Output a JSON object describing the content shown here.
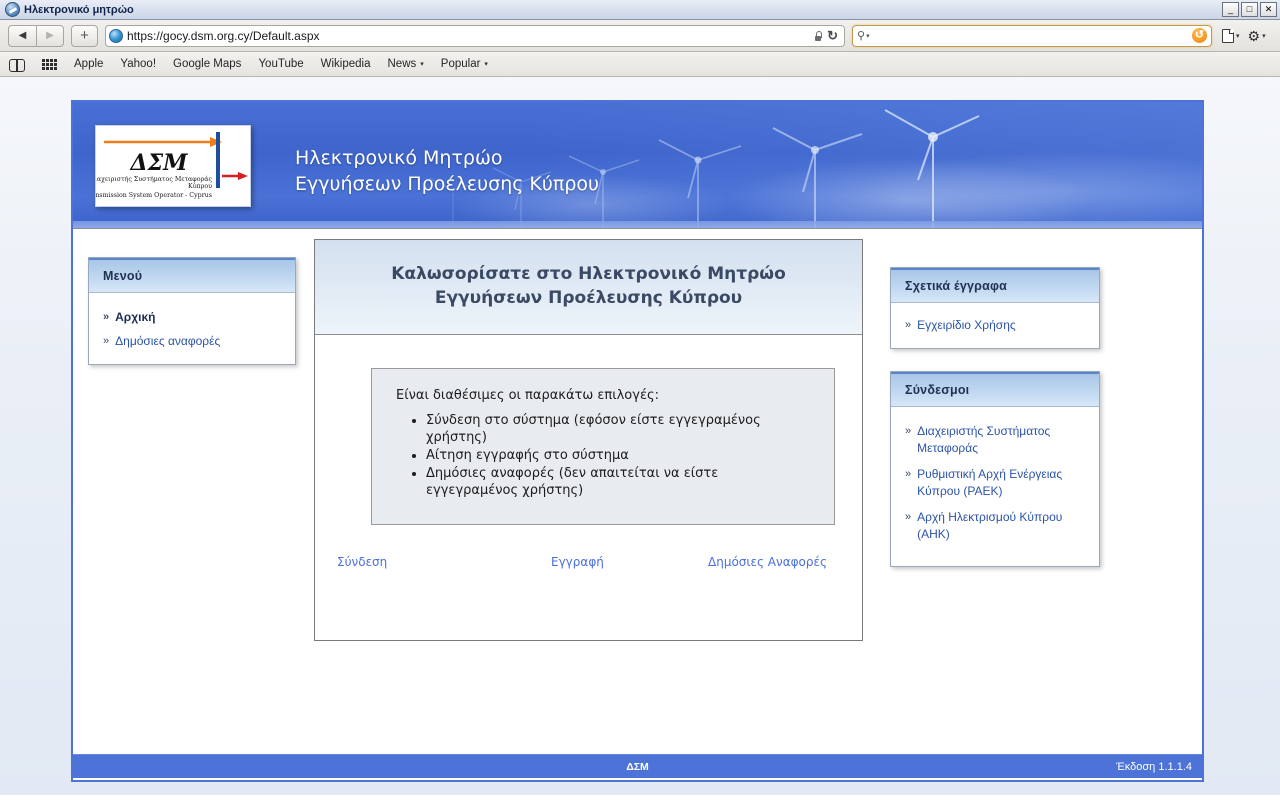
{
  "window": {
    "title": "Ηλεκτρονικό μητρώο",
    "icon": "compass-icon",
    "minimize": "_",
    "maximize": "□",
    "close": "✕"
  },
  "browser": {
    "back_icon": "◀",
    "forward_icon": "▶",
    "new_tab_icon": "+",
    "url": "https://gocy.dsm.org.cy/Default.aspx",
    "lock_icon": "lock-icon",
    "reload_icon": "↻",
    "search_placeholder": "",
    "search_value": "",
    "search_icon": "magnifier-icon",
    "search_caret": "▾",
    "stop_reload_icon": "↺",
    "page_menu_icon": "page-icon",
    "settings_icon": "gear-icon",
    "caret": "▾",
    "bookmarks": [
      {
        "label": "Apple",
        "has_caret": false
      },
      {
        "label": "Yahoo!",
        "has_caret": false
      },
      {
        "label": "Google Maps",
        "has_caret": false
      },
      {
        "label": "YouTube",
        "has_caret": false
      },
      {
        "label": "Wikipedia",
        "has_caret": false
      },
      {
        "label": "News",
        "has_caret": true
      },
      {
        "label": "Popular",
        "has_caret": true
      }
    ]
  },
  "site": {
    "banner": {
      "title_line1": "Ηλεκτρονικό Μητρώο",
      "title_line2": "Εγγυήσεων Προέλευσης Κύπρου",
      "logo": {
        "acronym": "ΔΣΜ",
        "subtitle_gr_line1": "Διαχειριστής Συστήματος Μεταφοράς",
        "subtitle_gr_line2": "Κύπρου",
        "subtitle_en": "Transmission System Operator - Cyprus"
      }
    },
    "menu_panel": {
      "title": "Μενού",
      "items": [
        {
          "label": "Αρχική",
          "active": true
        },
        {
          "label": "Δημόσιες αναφορές",
          "active": false
        }
      ]
    },
    "welcome": {
      "heading_line1": "Καλωσορίσατε στο Ηλεκτρονικό Μητρώο",
      "heading_line2": "Εγγυήσεων Προέλευσης Κύπρου",
      "intro": "Είναι διαθέσιμες οι παρακάτω επιλογές:",
      "options": [
        "Σύνδεση στο σύστημα (εφόσον είστε εγγεγραμένος χρήστης)",
        "Αίτηση εγγραφής στο σύστημα",
        "Δημόσιες αναφορές (δεν απαιτείται να είστε εγγεγραμένος χρήστης)"
      ],
      "actions": [
        {
          "label": "Σύνδεση"
        },
        {
          "label": "Εγγραφή"
        },
        {
          "label": "Δημόσιες Αναφορές"
        }
      ]
    },
    "documents_panel": {
      "title": "Σχετικά έγγραφα",
      "items": [
        {
          "label": "Εγχειρίδιο Χρήσης"
        }
      ]
    },
    "links_panel": {
      "title": "Σύνδεσμοι",
      "items": [
        {
          "label": "Διαχειριστής Συστήματος Μεταφοράς"
        },
        {
          "label": "Ρυθμιστική Αρχή Ενέργειας Κύπρου (ΡΑΕΚ)"
        },
        {
          "label": "Αρχή Ηλεκτρισμού Κύπρου (ΑΗΚ)"
        }
      ]
    },
    "footer": {
      "center": "ΔΣΜ",
      "version": "Έκδοση 1.1.1.4"
    },
    "chevron": "»",
    "colors": {
      "page_border": "#4d73d8",
      "footer_bg": "#4d73d8",
      "banner_blue": "#4169ce",
      "link_blue": "#2b53a8",
      "action_link_blue": "#4a6fe0",
      "panel_header_blue": "#bcd5ef"
    }
  }
}
